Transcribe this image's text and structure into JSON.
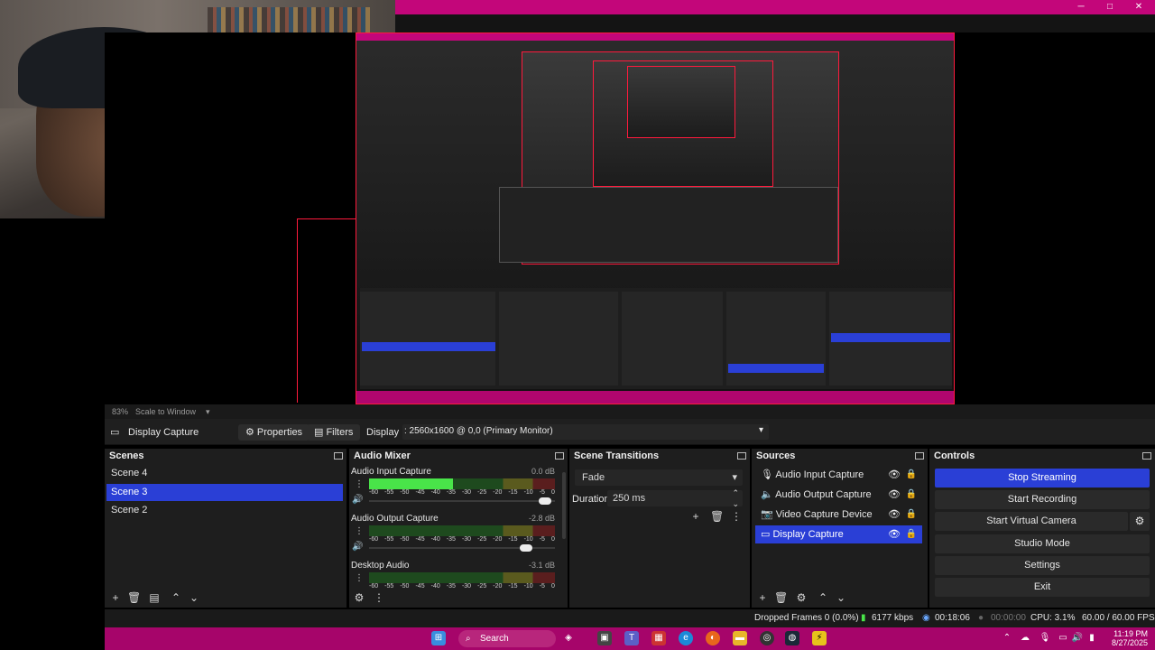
{
  "colors": {
    "accent": "#2a3fd6",
    "taskbar": "#a6056a",
    "titlebar": "#c3067a",
    "preview_border": "#ff1a3c"
  },
  "preview": {
    "zoom": "83%",
    "scale_mode": "Scale to Window"
  },
  "source_toolbar": {
    "source_name": "Display Capture",
    "properties_label": "Properties",
    "filters_label": "Filters",
    "display_label": "Display",
    "display_value": ": 2560x1600 @ 0,0 (Primary Monitor)"
  },
  "scenes": {
    "title": "Scenes",
    "items": [
      {
        "label": "Scene 4"
      },
      {
        "label": "Scene 3"
      },
      {
        "label": "Scene 2"
      }
    ],
    "selected": "Scene 3"
  },
  "mixer": {
    "title": "Audio Mixer",
    "ticks": [
      "-60",
      "-55",
      "-50",
      "-45",
      "-40",
      "-35",
      "-30",
      "-25",
      "-20",
      "-15",
      "-10",
      "-5",
      "0"
    ],
    "channels": [
      {
        "name": "Audio Input Capture",
        "db": "0.0 dB",
        "level": 0.45,
        "fader": 0.98
      },
      {
        "name": "Audio Output Capture",
        "db": "-2.8 dB",
        "level": 0.0,
        "fader": 0.88
      },
      {
        "name": "Desktop Audio",
        "db": "-3.1 dB",
        "level": 0.0,
        "fader": 0.9
      }
    ]
  },
  "transitions": {
    "title": "Scene Transitions",
    "selected": "Fade",
    "duration_label": "Duration",
    "duration_value": "250 ms"
  },
  "sources": {
    "title": "Sources",
    "items": [
      {
        "label": "Audio Input Capture",
        "icon": "microphone-icon"
      },
      {
        "label": "Audio Output Capture",
        "icon": "speaker-icon"
      },
      {
        "label": "Video Capture Device",
        "icon": "camera-icon"
      },
      {
        "label": "Display Capture",
        "icon": "monitor-icon"
      }
    ],
    "selected": "Display Capture"
  },
  "controls": {
    "title": "Controls",
    "stop_streaming": "Stop Streaming",
    "start_recording": "Start Recording",
    "start_virtual_camera": "Start Virtual Camera",
    "studio_mode": "Studio Mode",
    "settings": "Settings",
    "exit": "Exit"
  },
  "status": {
    "dropped_frames": "Dropped Frames 0 (0.0%)",
    "bitrate": "6177 kbps",
    "stream_time": "00:18:06",
    "record_time": "00:00:00",
    "cpu": "CPU: 3.1%",
    "fps": "60.00 / 60.00 FPS"
  },
  "taskbar": {
    "search_label": "Search",
    "time": "11:19 PM",
    "date": "8/27/2025"
  }
}
